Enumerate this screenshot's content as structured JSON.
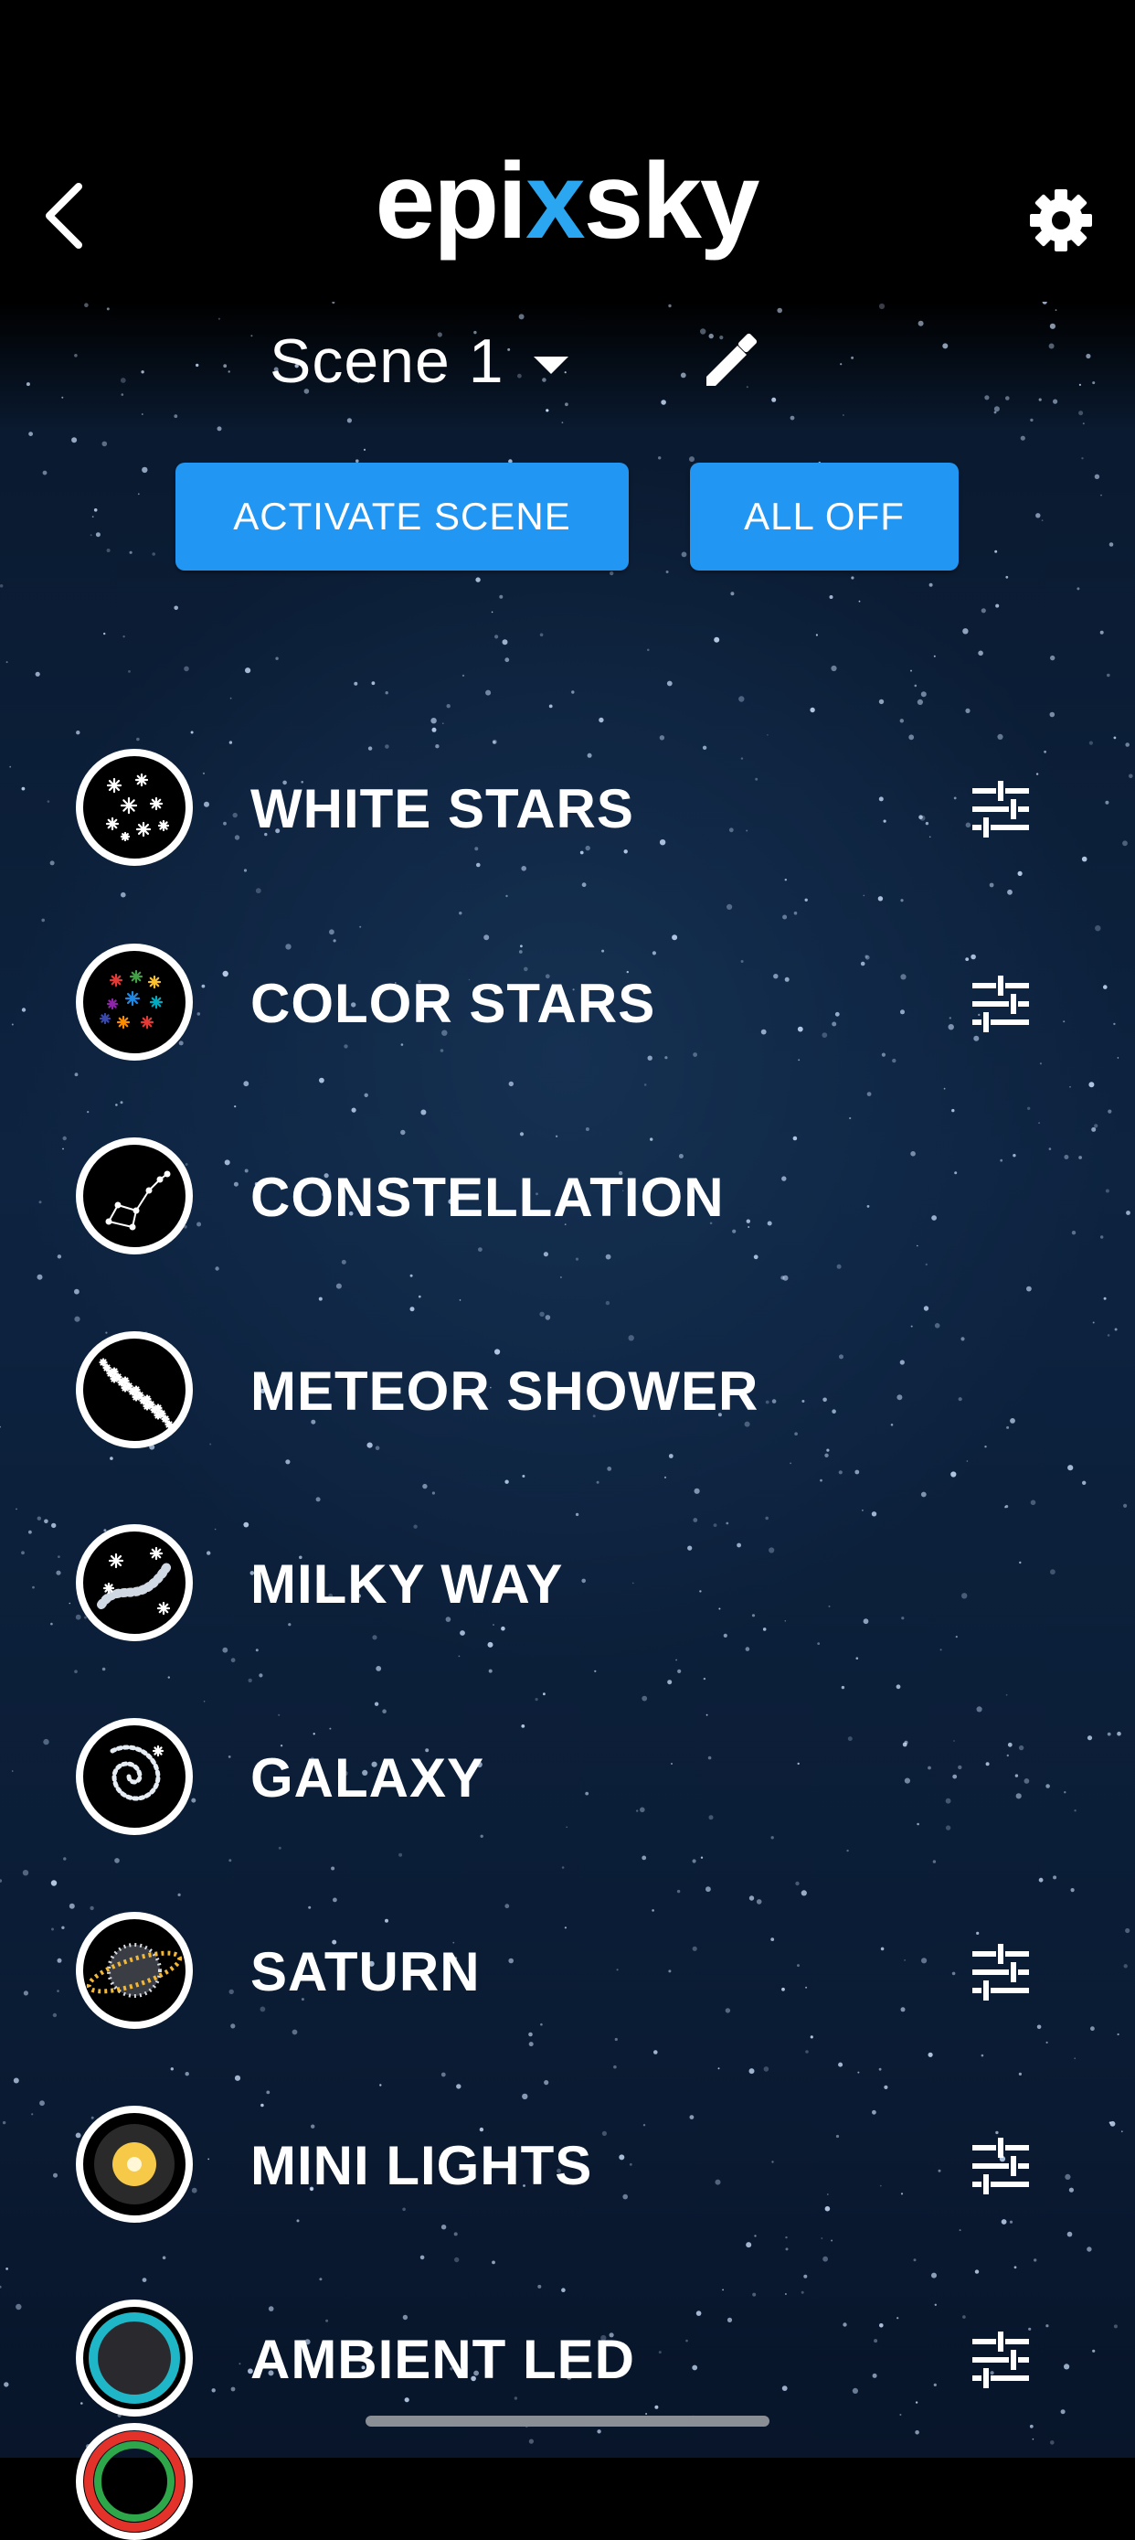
{
  "header": {
    "logo": {
      "prefix": "epi",
      "accent": "x",
      "suffix": "sky",
      "accent_color": "#2aa7f0"
    },
    "back_icon": "chevron-left",
    "settings_icon": "gear"
  },
  "scene": {
    "name": "Scene 1",
    "dropdown_icon": "caret-down",
    "edit_icon": "pencil"
  },
  "actions": {
    "activate_label": "ACTIVATE SCENE",
    "all_off_label": "ALL OFF",
    "button_color": "#2196f3"
  },
  "effects": [
    {
      "label": "WHITE STARS",
      "icon": "white-stars",
      "has_settings": true
    },
    {
      "label": "COLOR STARS",
      "icon": "color-stars",
      "has_settings": true
    },
    {
      "label": "CONSTELLATION",
      "icon": "constellation",
      "has_settings": false
    },
    {
      "label": "METEOR SHOWER",
      "icon": "meteor-shower",
      "has_settings": false
    },
    {
      "label": "MILKY WAY",
      "icon": "milky-way",
      "has_settings": false
    },
    {
      "label": "GALAXY",
      "icon": "galaxy",
      "has_settings": false
    },
    {
      "label": "SATURN",
      "icon": "saturn",
      "has_settings": true
    },
    {
      "label": "MINI LIGHTS",
      "icon": "mini-lights",
      "has_settings": true
    },
    {
      "label": "AMBIENT LED",
      "icon": "ambient-led",
      "has_settings": true
    }
  ]
}
